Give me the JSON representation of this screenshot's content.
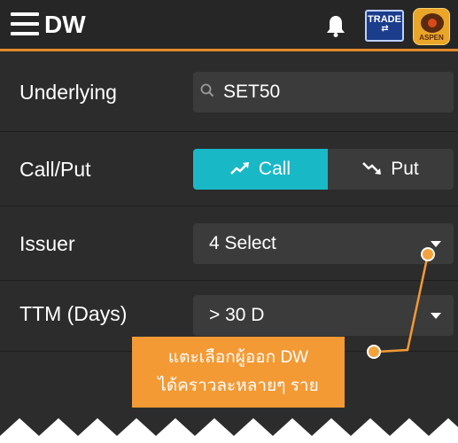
{
  "header": {
    "title": "DW",
    "icons": [
      "hamburger-menu-icon",
      "bell-icon",
      "trade-icon",
      "aspen-logo"
    ],
    "trade_label": "TRADE",
    "aspen_label": "ASPEN",
    "accent_color": "#e48a2a"
  },
  "form": {
    "underlying": {
      "label": "Underlying",
      "value": "SET50",
      "icon": "search-icon"
    },
    "call_put": {
      "label": "Call/Put",
      "call_label": "Call",
      "put_label": "Put",
      "selected": "Call",
      "selected_color": "#19b8c7"
    },
    "issuer": {
      "label": "Issuer",
      "value": "4 Select"
    },
    "ttm": {
      "label": "TTM (Days)",
      "value": "> 30 D"
    }
  },
  "annotation": {
    "line1": "แตะเลือกผู้ออก  DW",
    "line2": "ได้คราวละหลายๆ  ราย",
    "color": "#f39a35"
  }
}
